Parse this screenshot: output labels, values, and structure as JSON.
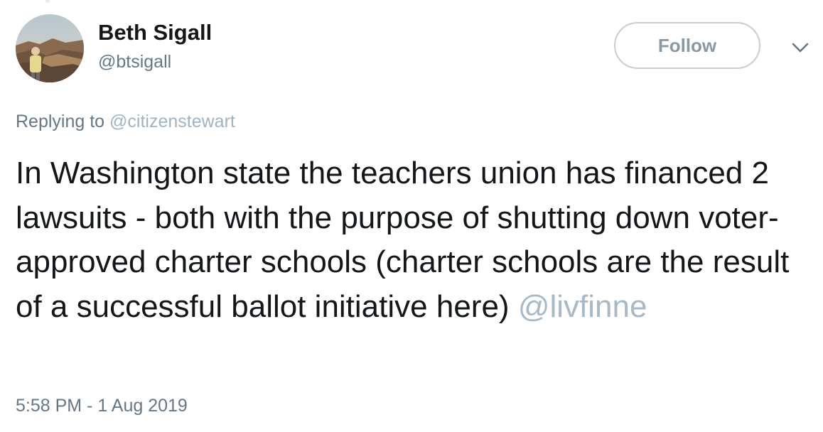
{
  "user": {
    "display_name": "Beth Sigall",
    "handle": "@btsigall",
    "avatar": "avatar-photo-canyon"
  },
  "header": {
    "follow_label": "Follow",
    "menu_icon": "chevron-down-icon"
  },
  "reply": {
    "prefix": "Replying to",
    "to": "@citizenstewart"
  },
  "tweet": {
    "text": "In Washington state the teachers union has financed 2 lawsuits - both with the purpose of shutting down voter-approved charter schools (charter schools are the result of a successful ballot initiative here)",
    "mention": "@livfinne"
  },
  "timestamp": "5:58 PM - 1 Aug 2019",
  "colors": {
    "primary_text": "#14171a",
    "secondary_text": "#657786",
    "mention": "#a7b8c6",
    "button_border": "#c4cfd6"
  }
}
